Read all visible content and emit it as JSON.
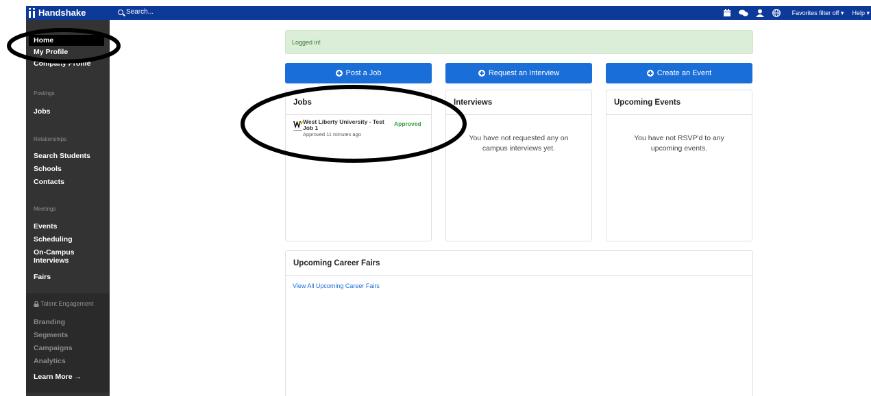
{
  "topbar": {
    "brand": "Handshake",
    "search_placeholder": "Search...",
    "favorites_label": "Favorites filter off ▾",
    "help_label": "Help ▾",
    "icons": [
      "calendar-icon",
      "chat-icon",
      "user-icon",
      "globe-icon"
    ]
  },
  "sidebar": {
    "home": "Home",
    "my_profile": "My Profile",
    "company_profile": "Company Profile",
    "postings_head": "Postings",
    "jobs": "Jobs",
    "relationships_head": "Relationships",
    "search_students": "Search Students",
    "schools": "Schools",
    "contacts": "Contacts",
    "meetings_head": "Meetings",
    "events": "Events",
    "scheduling": "Scheduling",
    "on_campus": "On-Campus",
    "interviews": "Interviews",
    "fairs": "Fairs",
    "talent_head": "Talent Engagement",
    "branding": "Branding",
    "segments": "Segments",
    "campaigns": "Campaigns",
    "analytics": "Analytics",
    "learn_more": "Learn More →"
  },
  "alert": {
    "message": "Logged in!"
  },
  "actions": {
    "post_job": "Post a Job",
    "request_interview": "Request an Interview",
    "create_event": "Create an Event"
  },
  "jobs_card": {
    "title": "Jobs",
    "job_title": "West Liberty University - Test Job 1",
    "job_sub": "Approved 11 minutes ago",
    "job_status": "Approved"
  },
  "interviews_card": {
    "title": "Interviews",
    "empty_line1": "You have not requested any on",
    "empty_line2": "campus interviews yet."
  },
  "events_card": {
    "title": "Upcoming Events",
    "empty_line1": "You have not RSVP'd to any",
    "empty_line2": "upcoming events."
  },
  "fairs_card": {
    "title": "Upcoming Career Fairs",
    "link": "View All Upcoming Career Fairs"
  },
  "colors": {
    "topbar": "#0d3a99",
    "sidebar": "#333333",
    "primary_button": "#1a6ed8",
    "alert_bg": "#dbeed7",
    "approved": "#3aa33a"
  }
}
